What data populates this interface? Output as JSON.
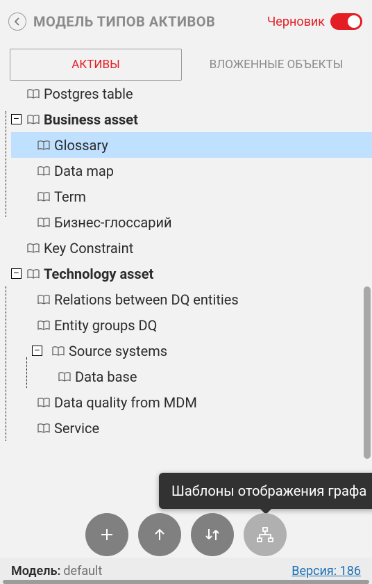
{
  "header": {
    "title": "МОДЕЛЬ ТИПОВ АКТИВОВ",
    "draft_label": "Черновик",
    "toggle_on": true
  },
  "tabs": {
    "active": "АКТИВЫ",
    "inactive": "ВЛОЖЕННЫЕ ОБЪЕКТЫ"
  },
  "tree": {
    "nodes": [
      {
        "label": "Postgres table",
        "level": 0,
        "bold": false,
        "expanded": null,
        "selected": false,
        "cut": true
      },
      {
        "label": "Business asset",
        "level": 0,
        "bold": true,
        "expanded": true,
        "selected": false
      },
      {
        "label": "Glossary",
        "level": 1,
        "bold": false,
        "expanded": null,
        "selected": true
      },
      {
        "label": "Data map",
        "level": 1,
        "bold": false,
        "expanded": null,
        "selected": false
      },
      {
        "label": "Term",
        "level": 1,
        "bold": false,
        "expanded": null,
        "selected": false
      },
      {
        "label": "Бизнес-глоссарий",
        "level": 1,
        "bold": false,
        "expanded": null,
        "selected": false
      },
      {
        "label": "Key Constraint",
        "level": 0,
        "bold": false,
        "expanded": null,
        "selected": false
      },
      {
        "label": "Technology asset",
        "level": 0,
        "bold": true,
        "expanded": true,
        "selected": false
      },
      {
        "label": "Relations between DQ entities",
        "level": 1,
        "bold": false,
        "expanded": null,
        "selected": false
      },
      {
        "label": "Entity groups DQ",
        "level": 1,
        "bold": false,
        "expanded": null,
        "selected": false
      },
      {
        "label": "Source systems",
        "level": 1,
        "bold": false,
        "expanded": true,
        "selected": false
      },
      {
        "label": "Data base",
        "level": 2,
        "bold": false,
        "expanded": null,
        "selected": false
      },
      {
        "label": "Data quality from MDM",
        "level": 1,
        "bold": false,
        "expanded": null,
        "selected": false
      },
      {
        "label": "Service",
        "level": 1,
        "bold": false,
        "expanded": null,
        "selected": false
      }
    ]
  },
  "tooltip": "Шаблоны отображения графа",
  "fab": {
    "add": "add-button",
    "up": "upload-button",
    "swap": "swap-button",
    "graph": "graph-templates-button"
  },
  "footer": {
    "model_label": "Модель:",
    "model_value": "default",
    "version_label": "Версия:",
    "version_value": "186"
  }
}
